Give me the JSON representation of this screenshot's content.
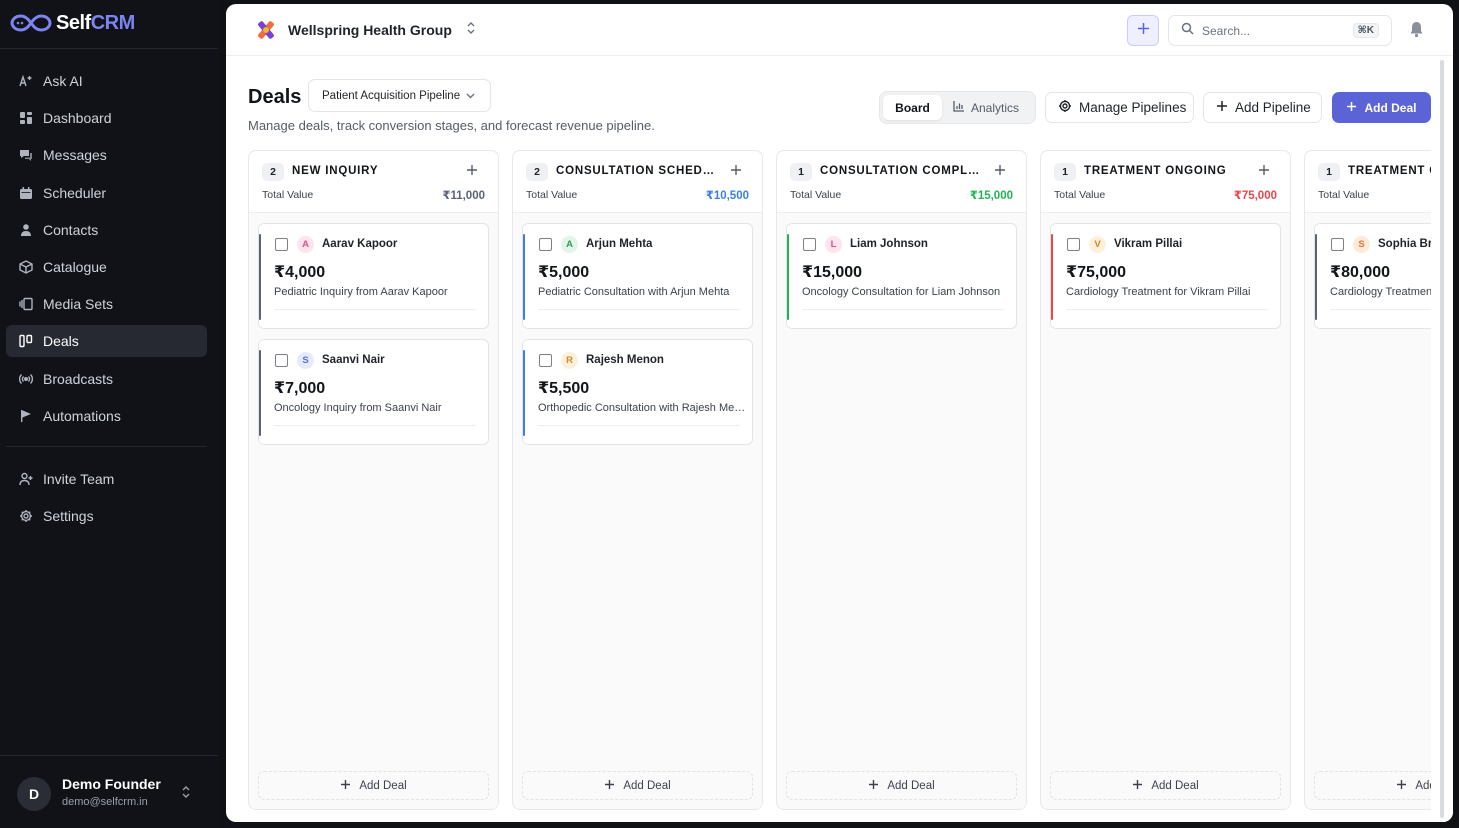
{
  "brand": {
    "self": "Self",
    "crm": "CRM"
  },
  "sidebar": {
    "nav": [
      {
        "label": "Ask AI",
        "icon": "sparkle-text-icon",
        "active": false
      },
      {
        "label": "Dashboard",
        "icon": "dashboard-grid-icon",
        "active": false
      },
      {
        "label": "Messages",
        "icon": "chat-bubbles-icon",
        "active": false
      },
      {
        "label": "Scheduler",
        "icon": "calendar-icon",
        "active": false
      },
      {
        "label": "Contacts",
        "icon": "user-icon",
        "active": false
      },
      {
        "label": "Catalogue",
        "icon": "package-box-icon",
        "active": false
      },
      {
        "label": "Media Sets",
        "icon": "gallery-icon",
        "active": false
      },
      {
        "label": "Deals",
        "icon": "kanban-icon",
        "active": true
      },
      {
        "label": "Broadcasts",
        "icon": "broadcast-icon",
        "active": false
      },
      {
        "label": "Automations",
        "icon": "flag-icon",
        "active": false
      }
    ],
    "secondary": [
      {
        "label": "Invite Team",
        "icon": "user-plus-icon"
      },
      {
        "label": "Settings",
        "icon": "gear-icon"
      }
    ],
    "user": {
      "initial": "D",
      "name": "Demo Founder",
      "email": "demo@selfcrm.in"
    }
  },
  "topbar": {
    "org_name": "Wellspring Health Group",
    "search_placeholder": "Search...",
    "shortcut": "⌘K"
  },
  "header": {
    "title": "Deals",
    "pipeline": "Patient Acquisition Pipeline",
    "subtitle": "Manage deals, track conversion stages, and forecast revenue pipeline.",
    "view_board": "Board",
    "view_analytics": "Analytics",
    "manage_pipelines": "Manage Pipelines",
    "add_pipeline": "Add Pipeline",
    "add_deal": "Add Deal"
  },
  "board": {
    "total_label": "Total Value",
    "add_deal_label": "Add Deal",
    "columns": [
      {
        "count": "2",
        "title": "NEW INQUIRY",
        "total": "₹11,000",
        "accent": "#5a6478",
        "deals": [
          {
            "initial": "A",
            "name": "Aarav Kapoor",
            "amount": "₹4,000",
            "desc": "Pediatric Inquiry from Aarav Kapoor",
            "av_bg": "#fde4ef",
            "av_fg": "#e0508a"
          },
          {
            "initial": "S",
            "name": "Saanvi Nair",
            "amount": "₹7,000",
            "desc": "Oncology Inquiry from Saanvi Nair",
            "av_bg": "#e6ebfc",
            "av_fg": "#5b6ee0"
          }
        ]
      },
      {
        "count": "2",
        "title": "CONSULTATION SCHEDULED",
        "total": "₹10,500",
        "accent": "#3b7fe0",
        "deals": [
          {
            "initial": "A",
            "name": "Arjun Mehta",
            "amount": "₹5,000",
            "desc": "Pediatric Consultation with Arjun Mehta",
            "av_bg": "#e3f5e9",
            "av_fg": "#2e9b58"
          },
          {
            "initial": "R",
            "name": "Rajesh Menon",
            "amount": "₹5,500",
            "desc": "Orthopedic Consultation with Rajesh Menon",
            "av_bg": "#fdf1dc",
            "av_fg": "#d08a1f"
          }
        ]
      },
      {
        "count": "1",
        "title": "CONSULTATION COMPLETED",
        "total": "₹15,000",
        "accent": "#22b357",
        "deals": [
          {
            "initial": "L",
            "name": "Liam Johnson",
            "amount": "₹15,000",
            "desc": "Oncology Consultation for Liam Johnson",
            "av_bg": "#fde4ef",
            "av_fg": "#e0508a"
          }
        ]
      },
      {
        "count": "1",
        "title": "TREATMENT ONGOING",
        "total": "₹75,000",
        "accent": "#e5484d",
        "deals": [
          {
            "initial": "V",
            "name": "Vikram Pillai",
            "amount": "₹75,000",
            "desc": "Cardiology Treatment for Vikram Pillai",
            "av_bg": "#fdf1dc",
            "av_fg": "#d08a1f"
          }
        ]
      },
      {
        "count": "1",
        "title": "TREATMENT COMPLETED",
        "total": "",
        "accent": "#5a6478",
        "deals": [
          {
            "initial": "S",
            "name": "Sophia Brown",
            "amount": "₹80,000",
            "desc": "Cardiology Treatment for Sophia Brown",
            "av_bg": "#fdeadb",
            "av_fg": "#e07a2e"
          }
        ]
      }
    ]
  }
}
